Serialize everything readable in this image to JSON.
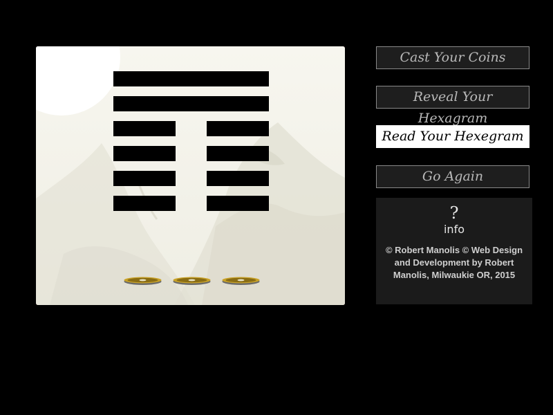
{
  "buttons": {
    "cast": "Cast Your Coins",
    "reveal": "Reveal Your Hexagram",
    "read": "Read Your Hexegram",
    "again": "Go Again"
  },
  "info": {
    "icon": "question-mark-icon",
    "label": "info",
    "credits": "© Robert Manolis © Web Design and Development by Robert Manolis, Milwaukie OR, 2015"
  },
  "hexagram": {
    "lines_top_to_bottom": [
      "solid",
      "solid",
      "broken",
      "broken",
      "broken",
      "broken"
    ]
  },
  "colors": {
    "page_background": "#000000",
    "panel_background": "#f5f4ec",
    "button_background": "#1e1e1e",
    "button_text": "#b9b9b9",
    "active_button_background": "#ffffff",
    "coin_gold": "#b8860b"
  }
}
